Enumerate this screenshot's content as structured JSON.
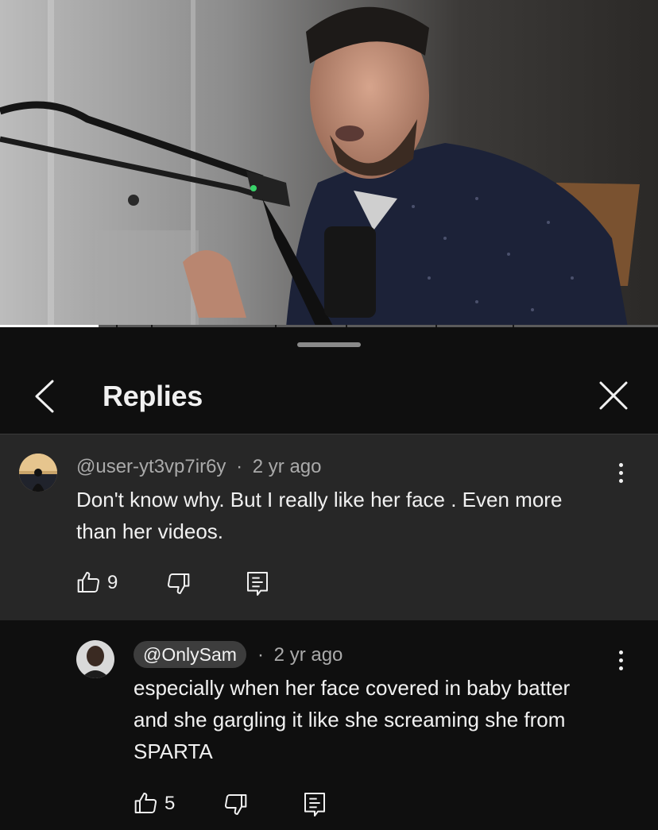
{
  "video": {
    "progress_fraction": 0.15
  },
  "sheet": {
    "title": "Replies"
  },
  "parent_comment": {
    "author": "@user-yt3vp7ir6y",
    "age": "2 yr ago",
    "separator": "·",
    "text": "Don't know why.  But I really like her face . Even more than her videos.",
    "likes": "9"
  },
  "reply_comment": {
    "author": "@OnlySam",
    "age": "2 yr ago",
    "separator": "·",
    "text": "especially when her face covered in baby batter and she gargling it like she screaming she from SPARTA",
    "likes": "5"
  },
  "colors": {
    "background": "#0f0f0f",
    "parent_background": "#272727",
    "chip_background": "#3d3d3d",
    "secondary_text": "#aaaaaa"
  }
}
